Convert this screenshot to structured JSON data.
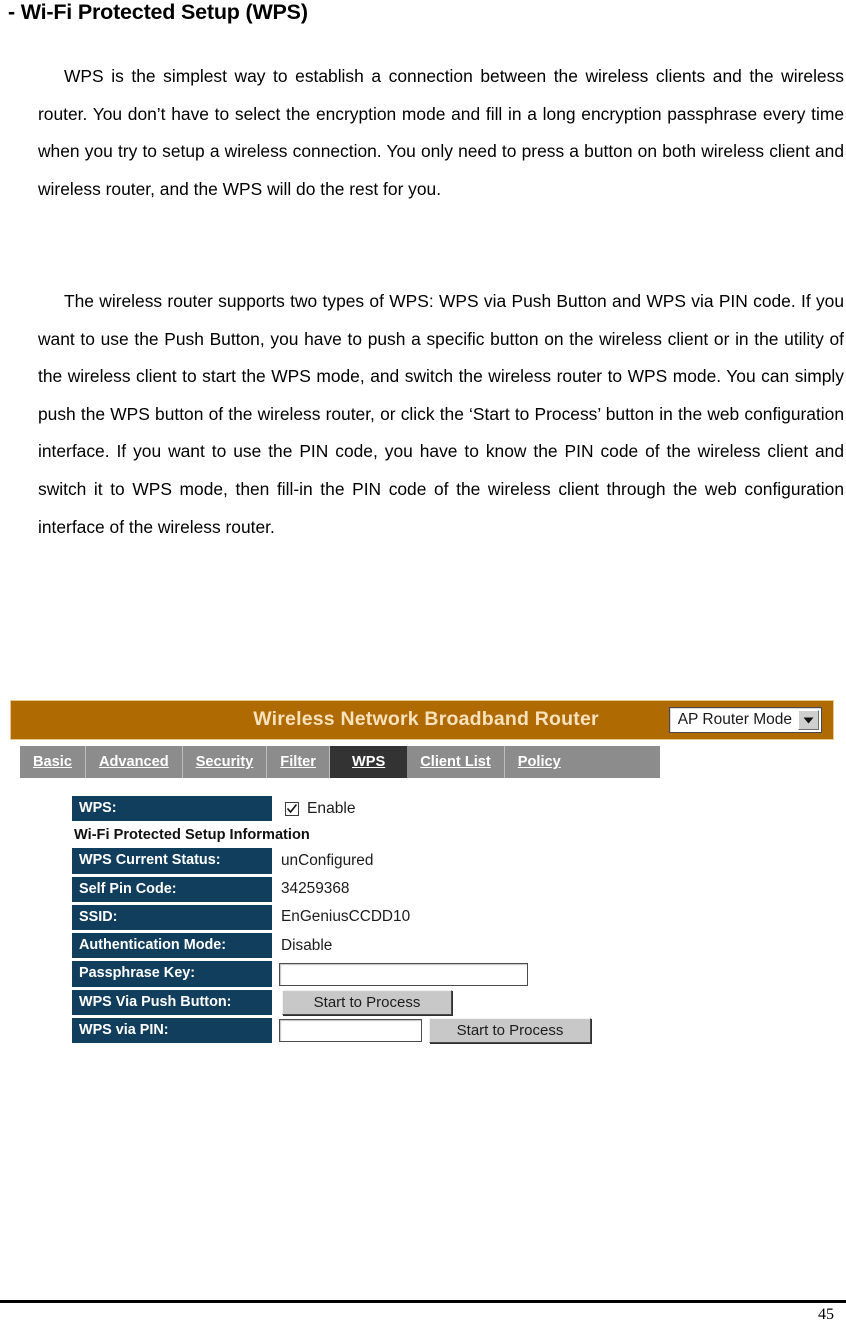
{
  "document": {
    "heading": "- Wi-Fi Protected Setup (WPS)",
    "paragraphs": [
      "WPS is the simplest way to establish a connection between the wireless clients and the wireless router. You don’t have to select the encryption mode and fill in a long encryption passphrase every time when you try to setup a wireless connection. You only need to press a button on both wireless client and wireless router, and the WPS will do the rest for you.",
      "The wireless router supports two types of WPS: WPS via Push Button and WPS via PIN code. If you want to use the Push Button, you have to push a specific button on the wireless client or in the utility of the wireless client to start the WPS mode, and switch the wireless router to WPS mode. You can simply push the WPS button of the wireless router, or click the ‘Start to Process’ button in the web configuration interface. If you want to use the PIN code, you have to know the PIN code of the wireless client and switch it to WPS mode, then fill-in the PIN code of the wireless client through the web configuration interface of the wireless router."
    ],
    "page_number": "45"
  },
  "router_ui": {
    "banner": {
      "title": "Wireless Network Broadband Router",
      "background_color": "#b06a02",
      "title_color": "#f7e2bb",
      "mode_select": {
        "selected": "AP Router Mode",
        "icon": "chevron-down-icon"
      }
    },
    "tabs": [
      {
        "label": "Basic",
        "active": false
      },
      {
        "label": "Advanced",
        "active": false
      },
      {
        "label": "Security",
        "active": false
      },
      {
        "label": "Filter",
        "active": false
      },
      {
        "label": "WPS",
        "active": true
      },
      {
        "label": "Client List",
        "active": false
      },
      {
        "label": "Policy",
        "active": false
      }
    ],
    "tab_colors": {
      "bar_background": "#8c8c8c",
      "active_background": "#333333",
      "label_color": "#ffffff"
    },
    "form": {
      "wps_label": "WPS:",
      "wps_checkbox_checked": true,
      "wps_checkbox_label": "Enable",
      "section_heading": "Wi-Fi Protected Setup Information",
      "rows": [
        {
          "label": "WPS Current Status:",
          "value": "unConfigured"
        },
        {
          "label": "Self Pin Code:",
          "value": "34259368"
        },
        {
          "label": "SSID:",
          "value": "EnGeniusCCDD10"
        },
        {
          "label": "Authentication Mode:",
          "value": "Disable"
        }
      ],
      "passphrase_label": "Passphrase Key:",
      "passphrase_value": "",
      "push_button_label": "WPS Via Push Button:",
      "push_button_text": "Start to Process",
      "pin_label": "WPS via PIN:",
      "pin_value": "",
      "pin_button_text": "Start to Process",
      "label_color": "#123e5e"
    }
  }
}
